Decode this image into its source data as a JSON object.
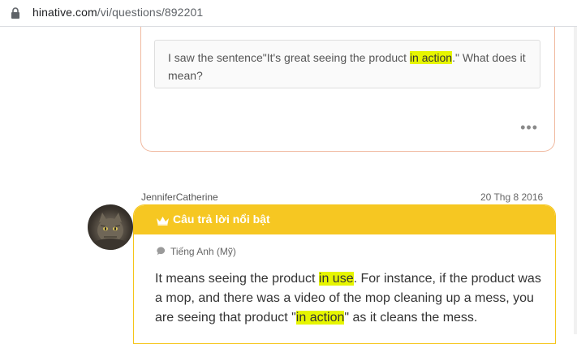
{
  "browser": {
    "url_host": "hinative.com",
    "url_path": "/vi/questions/892201"
  },
  "question": {
    "text_before": "I saw the sentence\"It's great seeing the product ",
    "highlight": "in action",
    "text_after": ".\" What does it mean?",
    "more_label": "•••"
  },
  "answer": {
    "author": "JenniferCatherine",
    "date": "20 Thg 8 2016",
    "badge": "Câu trả lời nổi bật",
    "language": "Tiếng Anh (Mỹ)",
    "part1": "It means seeing the product ",
    "hl1": "in use",
    "part2": ". For instance, if the product was a mop, and there was a video of the mop cleaning up a mess, you are seeing that product \"",
    "hl2": "in action",
    "part3": "\" as it cleans the mess."
  },
  "colors": {
    "highlight": "#e6f500",
    "featured_header": "#f6c722",
    "question_border": "#f0b9a0"
  }
}
